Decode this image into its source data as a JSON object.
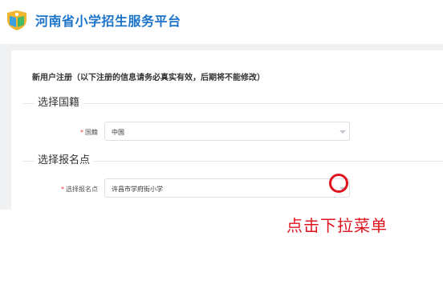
{
  "header": {
    "title": "河南省小学招生服务平台",
    "logo_icon": "book-shield-logo",
    "brand_color": "#1b73c9"
  },
  "form": {
    "title": "新用户注册（以下注册的信息请务必真实有效，后期将不能修改）"
  },
  "section_nationality": {
    "title": "选择国籍",
    "field_label": "国籍",
    "required_mark": "*",
    "selected_value": "中国"
  },
  "section_school": {
    "title": "选择报名点",
    "field_label": "选择报名点",
    "required_mark": "*",
    "selected_value": "许昌市学府街小学"
  },
  "annotation": {
    "text": "点击下拉菜单",
    "color": "#e0141e"
  }
}
